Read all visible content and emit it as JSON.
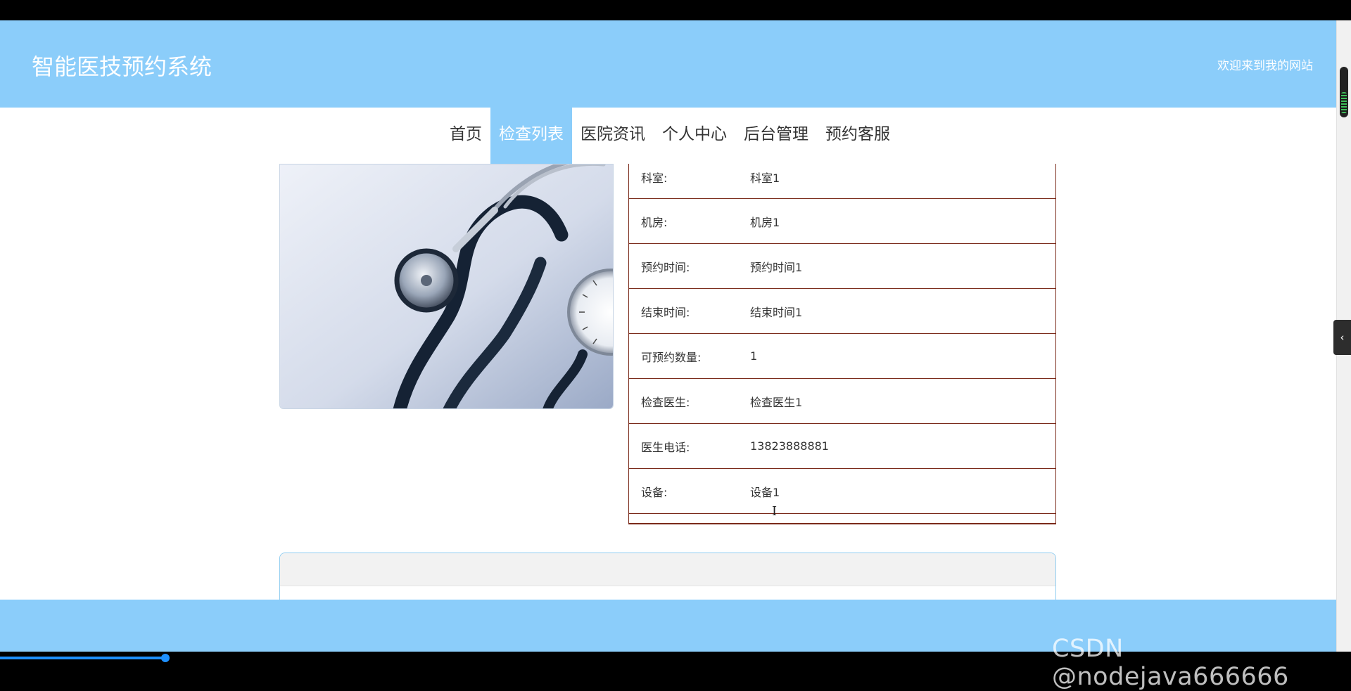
{
  "header": {
    "site_title": "智能医技预约系统",
    "welcome_text": "欢迎来到我的网站"
  },
  "nav": {
    "items": [
      {
        "label": "首页"
      },
      {
        "label": "检查列表"
      },
      {
        "label": "医院资讯"
      },
      {
        "label": "个人中心"
      },
      {
        "label": "后台管理"
      },
      {
        "label": "预约客服"
      }
    ],
    "active": "检查列表"
  },
  "detail": {
    "rows": [
      {
        "label": "科室:",
        "value": "科室1"
      },
      {
        "label": "机房:",
        "value": "机房1"
      },
      {
        "label": "预约时间:",
        "value": "预约时间1"
      },
      {
        "label": "结束时间:",
        "value": "结束时间1"
      },
      {
        "label": "可预约数量:",
        "value": "1"
      },
      {
        "label": "检查医生:",
        "value": "检查医生1"
      },
      {
        "label": "医生电话:",
        "value": "13823888881"
      },
      {
        "label": "设备:",
        "value": "设备1"
      }
    ]
  },
  "side_tab": {
    "icon": "chevron-left-icon",
    "glyph": "‹"
  },
  "watermark": "CSDN @nodejava666666",
  "colors": {
    "accent": "#8bcdfa",
    "table_border": "#7a2a1a"
  }
}
